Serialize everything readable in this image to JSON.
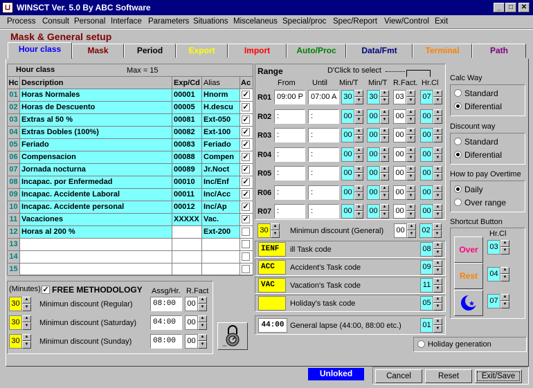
{
  "window": {
    "title": "WINSCT   Ver. 5.0  By ABC Software",
    "icon": "app-icon"
  },
  "menu": [
    "Process",
    "Consult",
    "Personal",
    "Interface",
    "Parameters",
    "Situations",
    "Miscelaneus",
    "Special/proc",
    "Spec/Report",
    "View/Control",
    "Exit"
  ],
  "page_title": "Mask & General setup",
  "tabs": [
    {
      "label": "Hour class",
      "color": "#0000ff"
    },
    {
      "label": "Mask",
      "color": "#800000"
    },
    {
      "label": "Period",
      "color": "#000000"
    },
    {
      "label": "Export",
      "color": "#ffff00"
    },
    {
      "label": "Import",
      "color": "#ff0000"
    },
    {
      "label": "Auto/Proc",
      "color": "#008000"
    },
    {
      "label": "Data/Fmt",
      "color": "#000080"
    },
    {
      "label": "Terminal",
      "color": "#ff8000"
    },
    {
      "label": "Path",
      "color": "#800080"
    }
  ],
  "hour_class": {
    "title": "Hour class",
    "max": "Max = 15",
    "headers": [
      "Hc",
      "Description",
      "Exp/Cd",
      "Alias",
      "Ac"
    ],
    "rows": [
      [
        "01",
        "Horas Normales",
        "00001",
        "Hnorm",
        true
      ],
      [
        "02",
        "Horas de Descuento",
        "00005",
        "H.descu",
        true
      ],
      [
        "03",
        "Extras al 50 %",
        "00081",
        "Ext-050",
        true
      ],
      [
        "04",
        "Extras Dobles (100%)",
        "00082",
        "Ext-100",
        true
      ],
      [
        "05",
        "Feriado",
        "00083",
        "Feriado",
        true
      ],
      [
        "06",
        "Compensacion",
        "00088",
        "Compen",
        true
      ],
      [
        "07",
        "Jornada nocturna",
        "00089",
        "Jr.Noct",
        true
      ],
      [
        "08",
        "Incapac. por Enfermedad",
        "00010",
        "Inc/Enf",
        true
      ],
      [
        "09",
        "Incapac. Accidente Laboral",
        "00011",
        "Inc/Acc",
        true
      ],
      [
        "10",
        "Incapac. Accidente personal",
        "00012",
        "Inc/Ap",
        true
      ],
      [
        "11",
        "Vacaciones",
        "XXXXX",
        "Vac.",
        true
      ],
      [
        "12",
        "Horas al 200 %",
        "",
        "Ext-200",
        false
      ],
      [
        "13",
        "",
        "",
        "",
        false
      ],
      [
        "14",
        "",
        "",
        "",
        false
      ],
      [
        "15",
        "",
        "",
        "",
        false
      ]
    ]
  },
  "minutes": {
    "label": "(Minutes)",
    "free_label": "FREE METHODOLOGY",
    "free_checked": true,
    "col1": "Assg/Hr.",
    "col2": "R.Fact",
    "rows": [
      {
        "val": "30",
        "label": "Minimun discount (Regular)",
        "assg": "08:00",
        "rf": "00"
      },
      {
        "val": "30",
        "label": "Minimun discount (Saturday)",
        "assg": "04:00",
        "rf": "00"
      },
      {
        "val": "30",
        "label": "Minimun discount (Sunday)",
        "assg": "08:00",
        "rf": "00"
      }
    ]
  },
  "range": {
    "title": "Range",
    "hint": "D'Click to select",
    "headers": [
      "From",
      "Until",
      "Min/T",
      "Min/T",
      "R.Fact.",
      "Hr.Cl"
    ],
    "rows": [
      {
        "id": "R01",
        "from": "09:00 P",
        "until": "07:00 A",
        "m1": "30",
        "m2": "30",
        "rf": "03",
        "hc": "07"
      },
      {
        "id": "R02",
        "from": " :",
        "until": " :",
        "m1": "00",
        "m2": "00",
        "rf": "00",
        "hc": "00"
      },
      {
        "id": "R03",
        "from": " :",
        "until": " :",
        "m1": "00",
        "m2": "00",
        "rf": "00",
        "hc": "00"
      },
      {
        "id": "R04",
        "from": " :",
        "until": " :",
        "m1": "00",
        "m2": "00",
        "rf": "00",
        "hc": "00"
      },
      {
        "id": "R05",
        "from": " :",
        "until": " :",
        "m1": "00",
        "m2": "00",
        "rf": "00",
        "hc": "00"
      },
      {
        "id": "R06",
        "from": " :",
        "until": " :",
        "m1": "00",
        "m2": "00",
        "rf": "00",
        "hc": "00"
      },
      {
        "id": "R07",
        "from": " :",
        "until": " :",
        "m1": "00",
        "m2": "00",
        "rf": "00",
        "hc": "00"
      }
    ],
    "min_discount": {
      "val": "30",
      "label": "Minimun discount (General)",
      "a": "00",
      "b": "02"
    },
    "tasks": [
      {
        "code": "IENF",
        "label": "ill Task code",
        "val": "08"
      },
      {
        "code": "ACC",
        "label": "Accident's Task code",
        "val": "09"
      },
      {
        "code": "VAC",
        "label": "Vacation's Task code",
        "val": "11"
      },
      {
        "code": "",
        "label": "Holiday's task code",
        "val": "05"
      }
    ],
    "lapse": {
      "code": "44:00",
      "label": "General lapse (44:00, 88:00 etc.)",
      "val": "01"
    },
    "holiday_gen": "Holiday generation"
  },
  "calc_way": {
    "title": "Calc Way",
    "opts": [
      "Standard",
      "Diferential"
    ],
    "selected": 1
  },
  "discount_way": {
    "title": "Discount way",
    "opts": [
      "Standard",
      "Diferential"
    ],
    "selected": 1
  },
  "overtime": {
    "title": "How to pay Overtime",
    "opts": [
      "Daily",
      "Over range"
    ],
    "selected": 0
  },
  "shortcut": {
    "title": "Shortcut Button",
    "hrcl": "Hr.Cl",
    "buttons": [
      {
        "label": "Over",
        "color": "#ff0080",
        "val": "03"
      },
      {
        "label": "Rest",
        "color": "#ff8000",
        "val": "04"
      },
      {
        "label": "",
        "color": "#0000ff",
        "val": "07"
      }
    ]
  },
  "status": "Unloked",
  "footer": {
    "cancel": "Cancel",
    "reset": "Reset",
    "exit": "Exit/Save"
  }
}
